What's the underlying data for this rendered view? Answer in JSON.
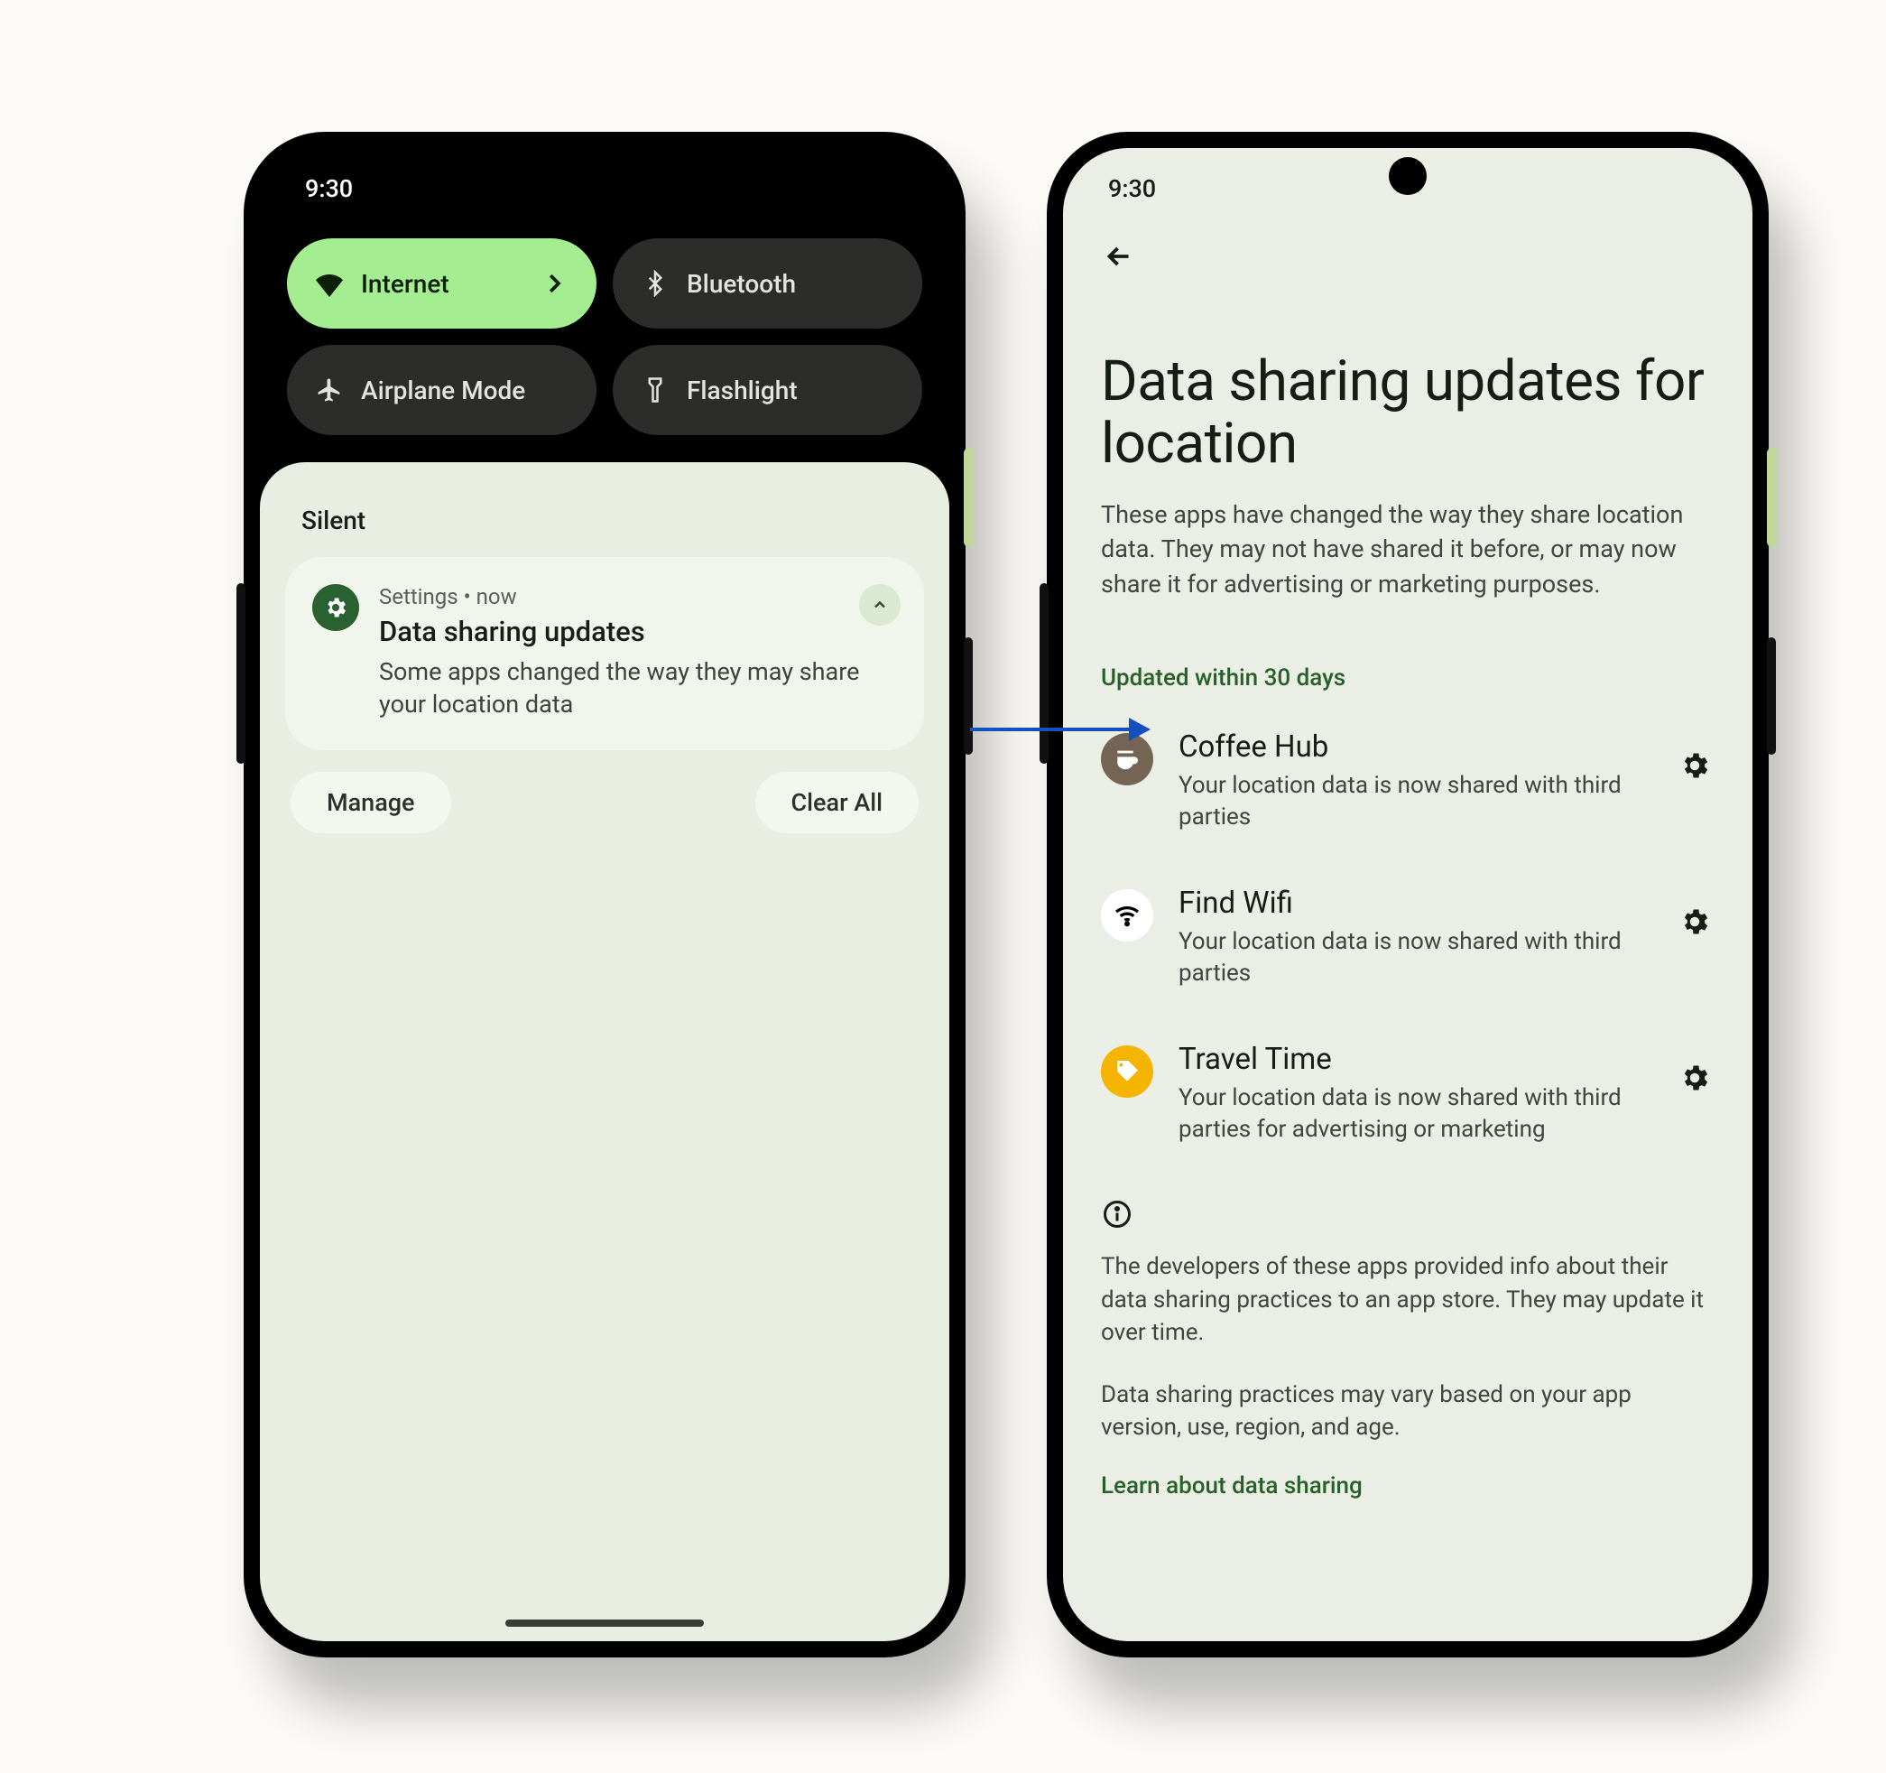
{
  "status": {
    "time": "9:30"
  },
  "left": {
    "qs": {
      "internet": "Internet",
      "bluetooth": "Bluetooth",
      "airplane": "Airplane Mode",
      "flashlight": "Flashlight"
    },
    "section_label": "Silent",
    "notif": {
      "app": "Settings",
      "when": "now",
      "meta_sep": "  •  ",
      "title": "Data sharing updates",
      "body": "Some apps changed the way they may share your location data"
    },
    "actions": {
      "manage": "Manage",
      "clear": "Clear All"
    }
  },
  "right": {
    "title": "Data sharing updates for location",
    "subtitle": "These apps have changed the way they share location data. They may not have shared it before, or may now share it for advertising or marketing purposes.",
    "section": "Updated within 30 days",
    "apps": {
      "coffee": {
        "name": "Coffee Hub",
        "desc": "Your location data is now shared with third parties"
      },
      "wifi": {
        "name": "Find Wifi",
        "desc": "Your location data is now shared with third parties"
      },
      "travel": {
        "name": "Travel Time",
        "desc": "Your location data is now shared with third parties for advertising or marketing"
      }
    },
    "info1": "The developers of these apps provided info about their data sharing practices to an app store. They may update it over time.",
    "info2": "Data sharing practices may vary based on your app version, use, region, and age.",
    "learn": "Learn about data sharing"
  }
}
